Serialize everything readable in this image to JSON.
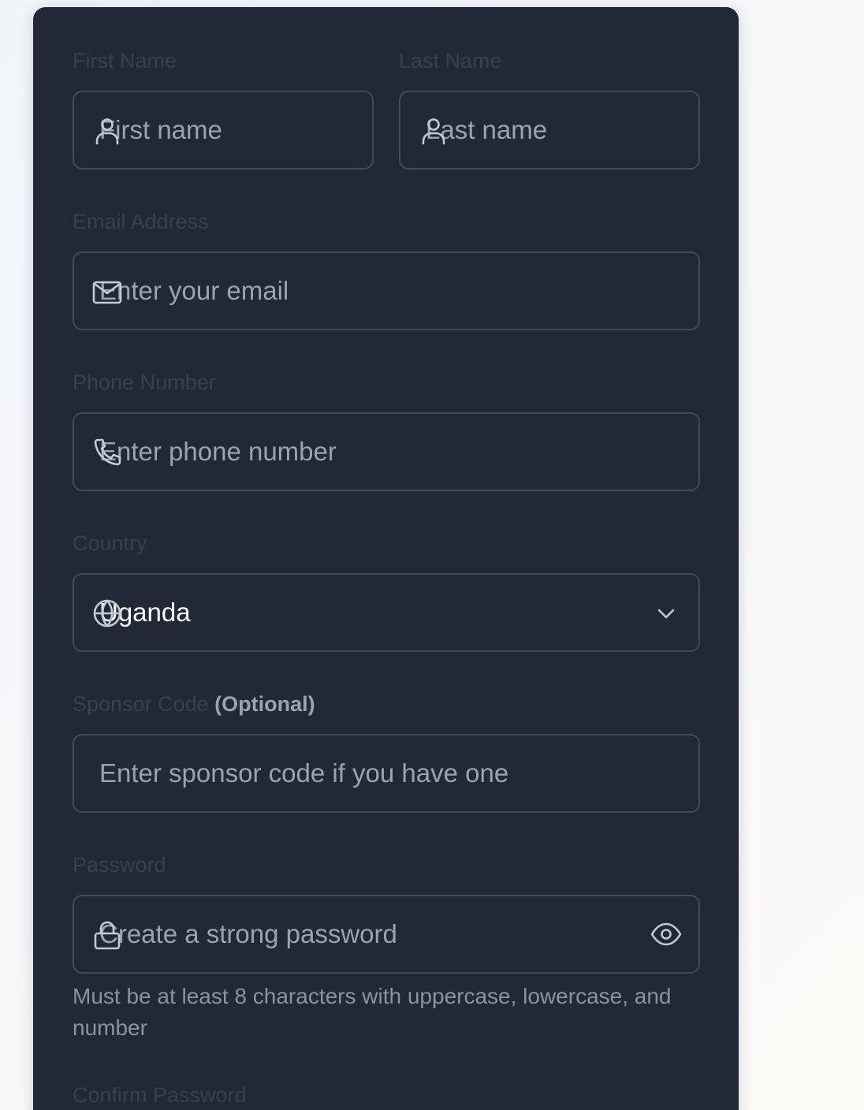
{
  "form": {
    "first_name": {
      "label": "First Name",
      "placeholder": "First name"
    },
    "last_name": {
      "label": "Last Name",
      "placeholder": "Last name"
    },
    "email": {
      "label": "Email Address",
      "placeholder": "Enter your email"
    },
    "phone": {
      "label": "Phone Number",
      "placeholder": "Enter phone number"
    },
    "country": {
      "label": "Country",
      "value": "Uganda"
    },
    "sponsor": {
      "label": "Sponsor Code",
      "optional": "(Optional)",
      "placeholder": "Enter sponsor code if you have one"
    },
    "password": {
      "label": "Password",
      "placeholder": "Create a strong password",
      "hint": "Must be at least 8 characters with uppercase, lowercase, and number"
    },
    "confirm_password": {
      "label": "Confirm Password"
    }
  },
  "icons": {
    "first_name": "user-icon",
    "last_name": "user-icon",
    "email": "mail-icon",
    "phone": "phone-icon",
    "country": "globe-icon",
    "country_dropdown": "chevron-down-icon",
    "password": "lock-icon",
    "password_toggle": "eye-icon"
  },
  "colors": {
    "card_background": "#222836",
    "input_border": "#434b59",
    "label_text": "#374152",
    "placeholder_text": "#9ba3b0",
    "value_text": "#ffffff"
  }
}
